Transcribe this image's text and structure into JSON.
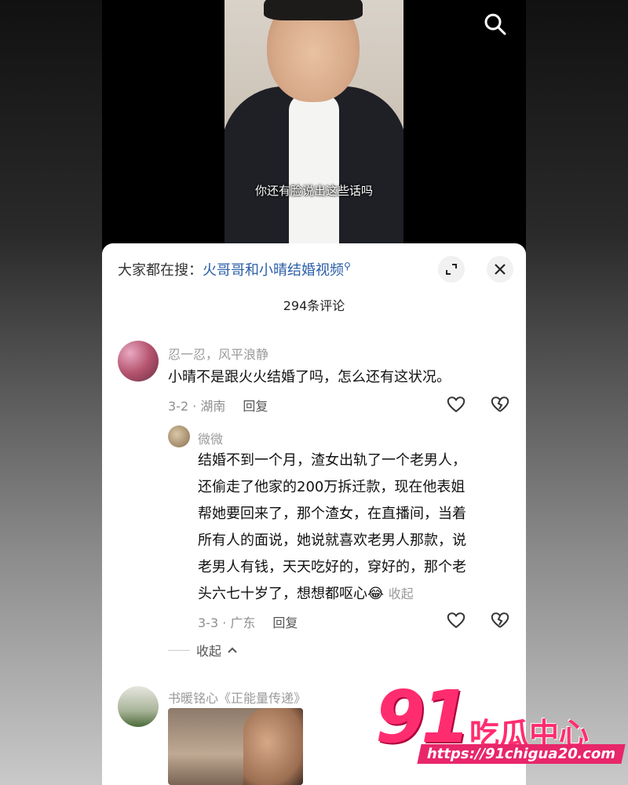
{
  "video": {
    "subtitle": "你还有脸说出这些话吗"
  },
  "icons": {
    "search": "search-icon",
    "expand": "expand-icon",
    "close": "close-icon",
    "like": "heart-outline-icon",
    "dislike": "broken-heart-icon"
  },
  "panel": {
    "hot_search_prefix": "大家都在搜：",
    "hot_search_link": "火哥哥和小晴结婚视频",
    "comment_count": "294条评论"
  },
  "comments": [
    {
      "user": "忍一忍，风平浪静",
      "text": "小晴不是跟火火结婚了吗，怎么还有这状况。",
      "date_location": "3-2 · 湖南",
      "reply_label": "回复"
    },
    {
      "user": "微微",
      "text_lines": [
        "结婚不到一个月，渣女出轨了一个老男人，",
        "还偷走了他家的200万拆迁款，现在他表姐",
        "帮她要回来了，那个渣女，在直播间，当着",
        "所有人的面说，她说就喜欢老男人那款，说",
        "老男人有钱，天天吃好的，穿好的，那个老",
        "头六七十岁了，想想都呕心"
      ],
      "emoji": "😂",
      "collapse_inline": "收起",
      "date_location": "3-3 · 广东",
      "reply_label": "回复"
    },
    {
      "user": "书暖铭心《正能量传递》"
    }
  ],
  "collapse_label": "收起",
  "watermark": {
    "number": "91",
    "name": "吃瓜中心",
    "url": "https://91chigua20.com"
  },
  "colors": {
    "link": "#2b5ea8",
    "watermark": "#ff2d6f"
  }
}
